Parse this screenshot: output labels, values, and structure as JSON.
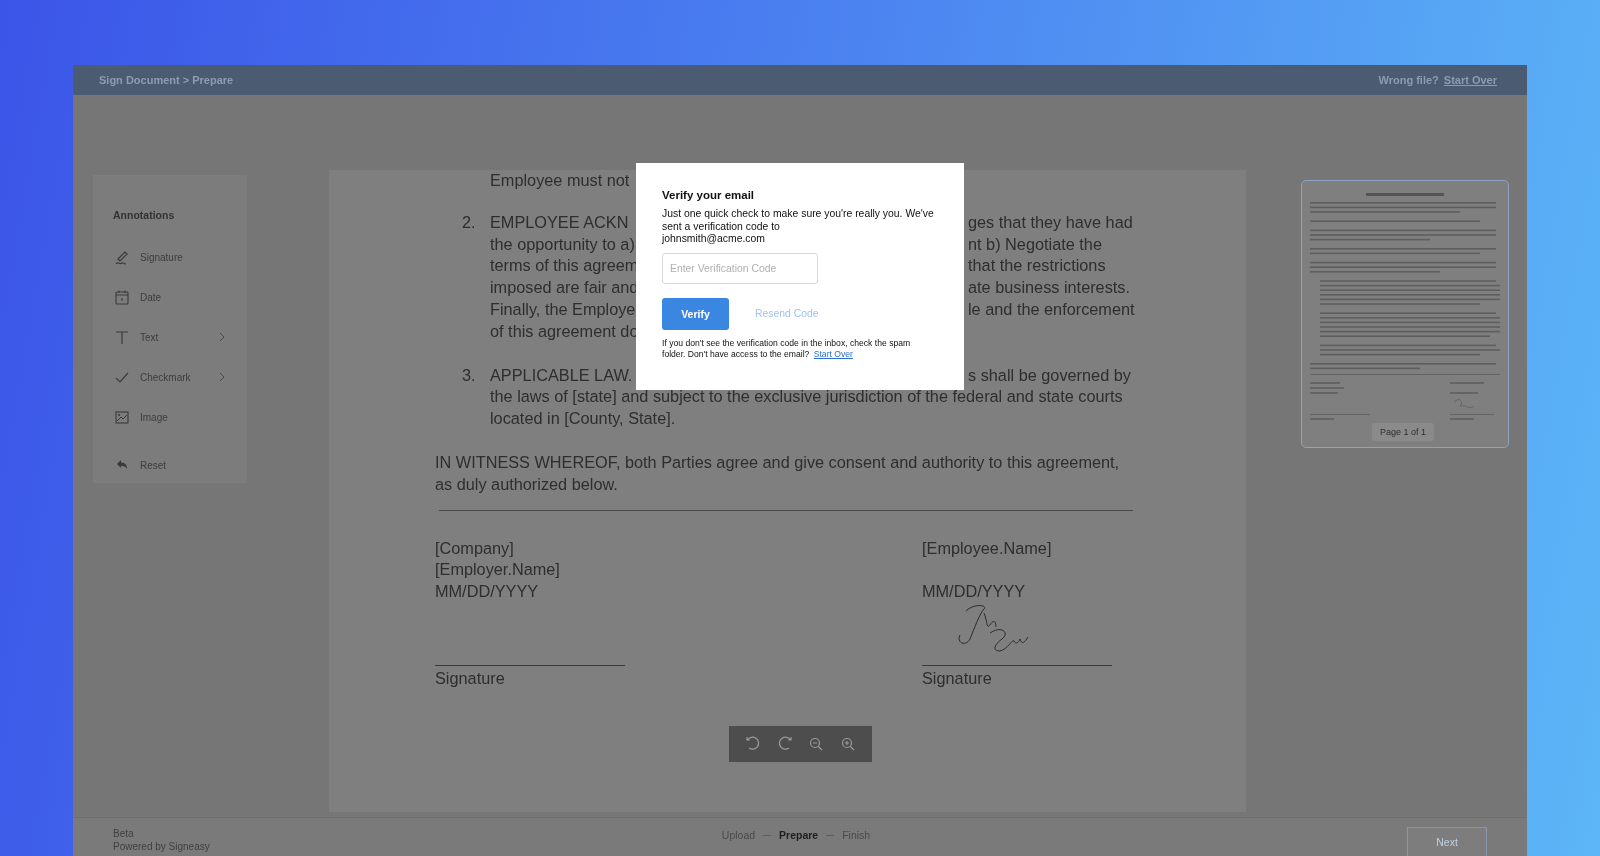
{
  "top_bar": {
    "breadcrumb": "Sign Document > Prepare",
    "wrong_file_label": "Wrong file?",
    "start_over_link": "Start Over"
  },
  "sidebar": {
    "title": "Annotations",
    "items": [
      {
        "label": "Signature",
        "submenu": false
      },
      {
        "label": "Date",
        "submenu": false
      },
      {
        "label": "Text",
        "submenu": true
      },
      {
        "label": "Checkmark",
        "submenu": true
      },
      {
        "label": "Image",
        "submenu": false
      }
    ],
    "reset_label": "Reset"
  },
  "document": {
    "items": [
      {
        "kind": "continuation",
        "lines": [
          {
            "left": "Employee must not"
          }
        ]
      },
      {
        "kind": "numbered",
        "number": "2.",
        "lines": [
          {
            "left": "EMPLOYEE ACKN",
            "right": "ges that they have had"
          },
          {
            "left": "the opportunity to a)",
            "right": "nt b) Negotiate the"
          },
          {
            "left": "terms of this agreem",
            "right": "that the restrictions"
          },
          {
            "left": "imposed are fair and",
            "right": "ate business interests."
          },
          {
            "left": "Finally, the Employe",
            "right": "le and the enforcement"
          },
          {
            "left": "of this agreement do"
          }
        ]
      },
      {
        "kind": "numbered",
        "number": "3.",
        "lines": [
          {
            "left": "APPLICABLE LAW.",
            "right": "s shall be governed by"
          },
          {
            "left": "the laws of [state] and subject to the exclusive jurisdiction of the federal and state courts"
          },
          {
            "left": "located in [County, State]."
          }
        ]
      }
    ],
    "witness": "IN WITNESS WHEREOF, both Parties agree and give consent and authority to this agreement, as duly authorized below.",
    "parties": [
      {
        "heading_lines": [
          "[Company]",
          "[Employer.Name]"
        ],
        "date": "MM/DD/YYYY",
        "signed": false,
        "signature_label": "Signature"
      },
      {
        "heading_lines": [
          "[Employee.Name]"
        ],
        "date": "MM/DD/YYYY",
        "signed": true,
        "signature_label": "Signature"
      }
    ]
  },
  "thumbnail": {
    "page_label": "Page 1 of 1",
    "selected": true
  },
  "modal": {
    "title": "Verify your email",
    "message": "Just one quick check to make sure you're really you. We've sent a verification code to",
    "email": "johnsmith@acme.com",
    "code_placeholder": "Enter Verification Code",
    "verify_button": "Verify",
    "resend_link": "Resend Code",
    "help_text": "If you don't see the verification code in the inbox, check the spam folder. Don't have access to the email?",
    "start_over_link": "Start Over"
  },
  "bottom_bar": {
    "beta_label": "Beta",
    "powered_by": "Powered by Signeasy",
    "steps": [
      {
        "label": "Upload",
        "selected": false
      },
      {
        "label": "Prepare",
        "selected": true
      },
      {
        "label": "Finish",
        "selected": false
      }
    ],
    "next_button": "Next"
  }
}
